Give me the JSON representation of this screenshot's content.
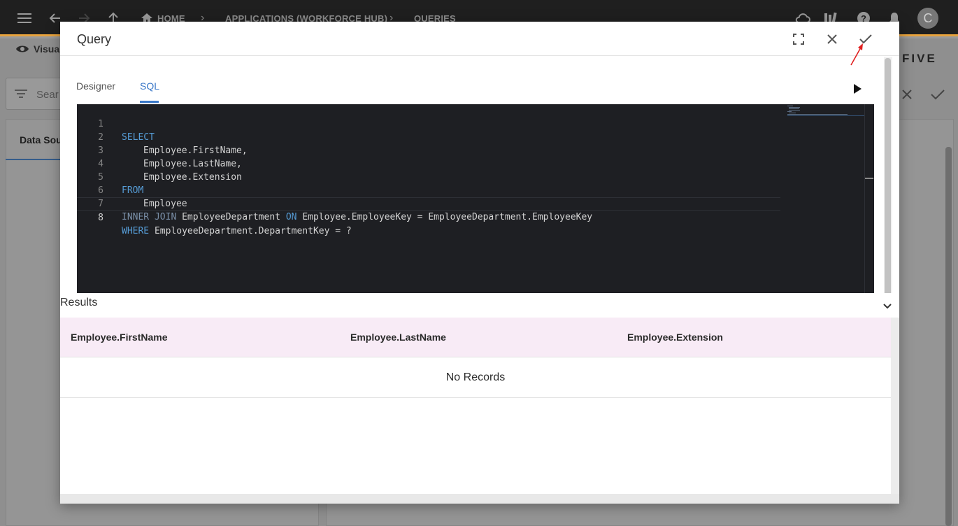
{
  "appbar": {
    "breadcrumbs": [
      "HOME",
      "APPLICATIONS (WORKFORCE HUB)",
      "QUERIES"
    ],
    "avatar_initial": "C"
  },
  "background": {
    "visual_label": "Visua",
    "brand": "FIVE",
    "search_placeholder": "Sear",
    "datasource_tab": "Data Sou"
  },
  "dialog": {
    "title": "Query",
    "tabs": [
      {
        "label": "Designer",
        "active": false
      },
      {
        "label": "SQL",
        "active": true
      }
    ],
    "editor": {
      "lines": [
        {
          "num": "1"
        },
        {
          "num": "2"
        },
        {
          "num": "3"
        },
        {
          "num": "4"
        },
        {
          "num": "5"
        },
        {
          "num": "6"
        },
        {
          "num": "7"
        },
        {
          "num": "8"
        }
      ],
      "tokens": {
        "select": "SELECT",
        "first_name": "Employee.FirstName,",
        "last_name": "Employee.LastName,",
        "extension": "Employee.Extension",
        "from": "FROM",
        "employee": "Employee",
        "inner_join": "INNER JOIN",
        "join_table": "EmployeeDepartment",
        "on": "ON",
        "join_cond": "Employee.EmployeeKey = EmployeeDepartment.EmployeeKey",
        "where": "WHERE",
        "where_cond": "EmployeeDepartment.DepartmentKey = ?"
      }
    },
    "results": {
      "label": "Results",
      "columns": [
        "Employee.FirstName",
        "Employee.LastName",
        "Employee.Extension"
      ],
      "empty_text": "No Records"
    }
  },
  "colors": {
    "accent": "#3a78c8",
    "keyword": "#569cd6",
    "table_header_bg": "#f8ebf6",
    "appbar_bg": "#1f1f1f",
    "appbar_border": "#e8a33d",
    "annotation_arrow": "#e02020"
  }
}
